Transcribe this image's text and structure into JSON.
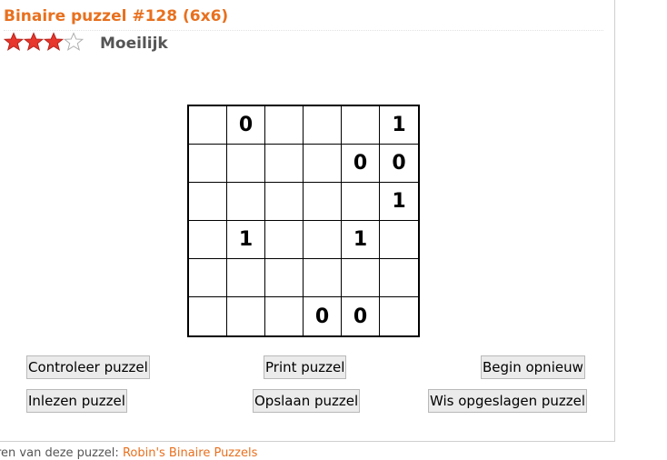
{
  "puzzle": {
    "title": "Binaire puzzel #128 (6x6)",
    "difficulty_label": "Moeilijk",
    "rating": {
      "filled": 3,
      "total": 4
    },
    "grid": [
      [
        "",
        "0",
        "",
        "",
        "",
        "1"
      ],
      [
        "",
        "",
        "",
        "",
        "0",
        "0"
      ],
      [
        "",
        "",
        "",
        "",
        "",
        "1"
      ],
      [
        "",
        "1",
        "",
        "",
        "1",
        ""
      ],
      [
        "",
        "",
        "",
        "",
        "",
        ""
      ],
      [
        "",
        "",
        "",
        "0",
        "0",
        ""
      ]
    ]
  },
  "buttons": {
    "check": "Controleer puzzel",
    "print": "Print puzzel",
    "restart": "Begin opnieuw",
    "load": "Inlezen puzzel",
    "save": "Opslaan puzzel",
    "clear_saved": "Wis opgeslagen puzzel"
  },
  "footer": {
    "text": "ren van deze puzzel: ",
    "link": "Robin's Binaire Puzzels"
  },
  "colors": {
    "accent": "#e8701e",
    "star_filled": "#e8372c",
    "star_empty": "#ffffff"
  }
}
